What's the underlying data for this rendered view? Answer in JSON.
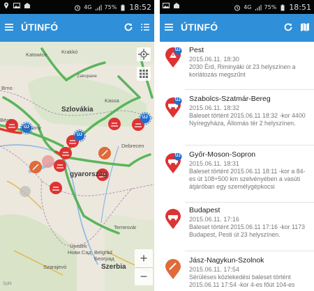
{
  "status_left": {
    "time": "18:52"
  },
  "status_right": {
    "time": "18:51"
  },
  "status": {
    "network": "4G",
    "battery": "75%"
  },
  "app": {
    "title": "ÚTINFÓ",
    "accent": "#2f8fd8"
  },
  "map": {
    "labels": [
      "Katowice",
      "Krakkó",
      "Zakopane",
      "Brno",
      "Szlovákia",
      "Kassa",
      "Bécs",
      "Pozsony",
      "Debrecen",
      "gyarország",
      "Temesvár",
      "Újvidék",
      "Нови Сад",
      "Belgrád",
      "Београд",
      "Szarajevó",
      "Szerbia",
      "Split"
    ],
    "zoom_in": "+",
    "zoom_out": "−",
    "badge": "ÚJ"
  },
  "list": {
    "badge": "ÚJ",
    "items": [
      {
        "name": "Pest",
        "date": "2015.06.11. 18:30",
        "desc": "2030 Érd, Riminyáki út 23 helyszínen a korlátozás megszűnt",
        "new": true,
        "icon": "roadwork-warning-icon"
      },
      {
        "name": "Szabolcs-Szatmár-Bereg",
        "date": "2015.06.11. 18:32",
        "desc": "Baleset történt 2015.06.11 18:32 -kor 4400 Nyíregyháza, Állomás tér 2 helyszínen.",
        "new": true,
        "icon": "accident-warning-icon"
      },
      {
        "name": "Győr-Moson-Sopron",
        "date": "2015.06.11. 18:31",
        "desc": "Baleset történt 2015.06.11 18:11 -kor a 84-es út 108+500 km szelvényében a vasúti átjáróban egy személygépkocsi",
        "new": true,
        "icon": "accident-warning-icon"
      },
      {
        "name": "Budapest",
        "date": "2015.06.11. 17:16",
        "desc": "Baleset történt 2015.06.11 17:16 -kor 1173 Budapest, Pesti út 23 helyszínen.",
        "new": false,
        "icon": "accident-warning-icon"
      },
      {
        "name": "Jász-Nagykun-Szolnok",
        "date": "2015.06.11. 17:54",
        "desc": "Sérüléses közlekedési baleset történt 2015.06.11 17:54 -kor 4-es főút 104-es",
        "new": false,
        "icon": "roadwork-warning-icon"
      }
    ]
  }
}
